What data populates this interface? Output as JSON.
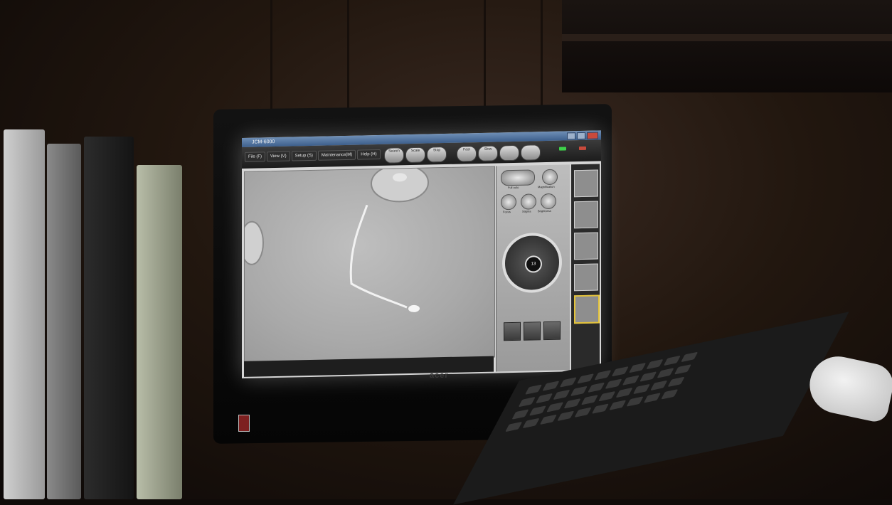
{
  "window": {
    "title": "JCM-6000"
  },
  "menu": {
    "items": [
      "File (F)",
      "View (V)",
      "Setup (S)",
      "Maintenance(M)",
      "Help (H)"
    ]
  },
  "toolbar_buttons": [
    {
      "label": "Search",
      "icon": "search-icon"
    },
    {
      "label": "Scale",
      "icon": "scale-icon"
    },
    {
      "label": "Stop",
      "icon": "stop-icon"
    },
    {
      "label": "Fast",
      "icon": "fast-scan-icon"
    },
    {
      "label": "Slow",
      "icon": "slow-scan-icon"
    },
    {
      "label": "",
      "icon": "scan-icon"
    },
    {
      "label": "",
      "icon": "scan-icon"
    }
  ],
  "controls": {
    "full_auto_label": "Full auto",
    "magnification_label": "Magnification",
    "focus_label": "Focus",
    "stigma_label": "Stigma",
    "brightness_label": "Brightness",
    "joystick_center": "13"
  },
  "colors": {
    "status_green": "#3ed14a",
    "title_bar": "#4f6f9c",
    "thumbnail_selected": "#e4c33a"
  },
  "device": {
    "brand": "acer"
  }
}
